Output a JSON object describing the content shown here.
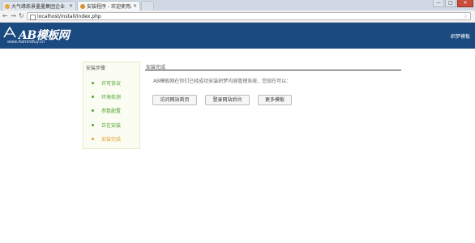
{
  "browser": {
    "tabs": [
      {
        "label": "大气缘炼景墨墨集团企业",
        "active": false
      },
      {
        "label": "安装程序 - 欢迎使用AB模板",
        "active": true
      }
    ],
    "address": "localhost/install/index.php",
    "controls": {
      "minimize": "—",
      "maximize": "□",
      "close": "✕"
    }
  },
  "header": {
    "logo_text": "AB模板网",
    "logo_url": "www.AdminBuy.cn",
    "right_text": "织梦模板"
  },
  "sidebar": {
    "title": "安装步骤",
    "steps": [
      {
        "label": "许可协议",
        "state": "done"
      },
      {
        "label": "环境检测",
        "state": "done"
      },
      {
        "label": "参数配置",
        "state": "done"
      },
      {
        "label": "正在安装",
        "state": "done"
      },
      {
        "label": "安装完成",
        "state": "active"
      }
    ]
  },
  "main": {
    "title": "安装完成",
    "message": "AB模板网在你们已经成功安装织梦内容管理系统，您现在可以：",
    "buttons": [
      "访问网站首页",
      "登录网站后台",
      "更多模板"
    ]
  },
  "colors": {
    "header_bg": "#1b4a80",
    "step_done": "#52a532",
    "step_active": "#e0a030"
  }
}
